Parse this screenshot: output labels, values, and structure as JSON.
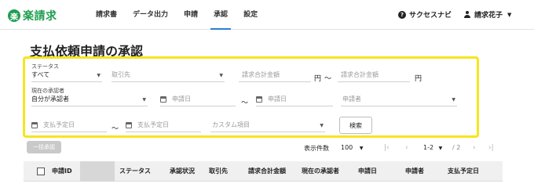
{
  "brand": {
    "mark": "楽",
    "name": "楽請求"
  },
  "nav": {
    "items": [
      {
        "label": "請求書"
      },
      {
        "label": "データ出力"
      },
      {
        "label": "申請"
      },
      {
        "label": "承認"
      },
      {
        "label": "設定"
      }
    ],
    "active_index": 3
  },
  "help": {
    "icon": "help-icon",
    "label": "サクセスナビ"
  },
  "user": {
    "icon": "user-icon",
    "name": "請求花子"
  },
  "page": {
    "title": "支払依頼申請の承認"
  },
  "filters": {
    "status": {
      "label": "ステータス",
      "value": "すべて"
    },
    "supplier": {
      "placeholder": "取引先"
    },
    "amount_min": {
      "placeholder": "請求合計金額",
      "unit": "円"
    },
    "range_sep": "〜",
    "amount_max": {
      "placeholder": "請求合計金額",
      "unit": "円"
    },
    "approver": {
      "label": "現在の承認者",
      "value": "自分が承認者"
    },
    "applied_from": {
      "placeholder": "申請日"
    },
    "applied_to": {
      "placeholder": "申請日"
    },
    "applicant": {
      "placeholder": "申請者"
    },
    "pay_from": {
      "placeholder": "支払予定日"
    },
    "pay_to": {
      "placeholder": "支払予定日"
    },
    "custom": {
      "placeholder": "カスタム項目"
    },
    "search_button": "検索"
  },
  "toolbar": {
    "bulk_approve": "一括承認",
    "count_label": "表示件数",
    "count_value": "100",
    "page_range": "1-2",
    "page_total": "/ 2"
  },
  "table": {
    "headers": [
      "申請ID",
      "ステータス",
      "承認状況",
      "取引先",
      "請求合計金額",
      "現在の承認者",
      "申請日",
      "申請者",
      "支払予定日"
    ]
  },
  "colors": {
    "brand": "#1e9e4f",
    "highlight": "#f5e51f",
    "nav_active": "#2b7fd3"
  }
}
